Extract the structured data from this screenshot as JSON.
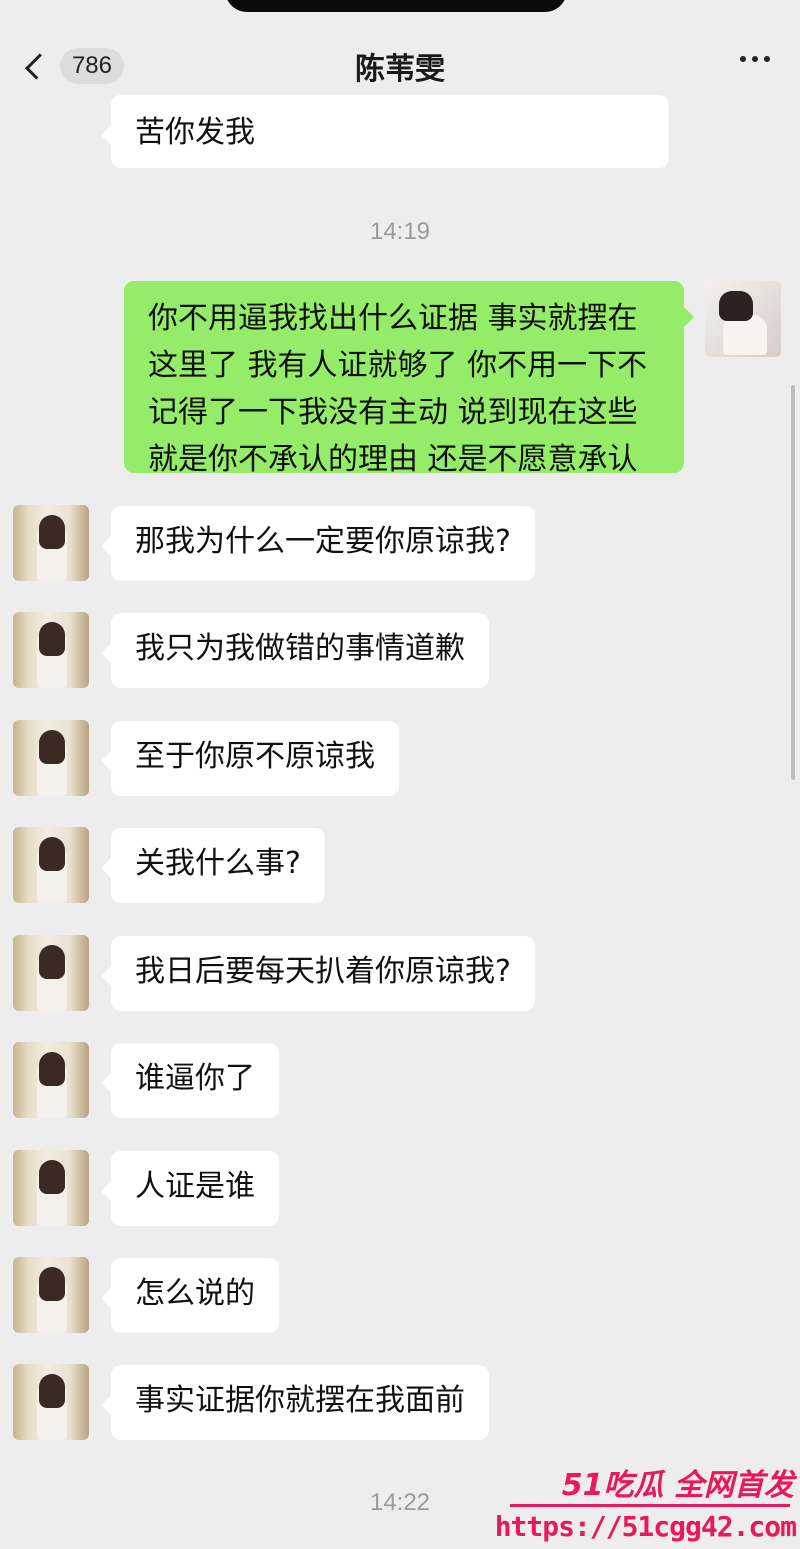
{
  "header": {
    "unread_count": "786",
    "chat_title": "陈苇雯"
  },
  "messages": {
    "partial_top": "苦你发我",
    "time_1": "14:19",
    "me_1": "你不用逼我找出什么证据 事实就摆在这里了 我有人证就够了 你不用一下不记得了一下我没有主动 说到现在这些就是你不承认的理由 还是不愿意承认",
    "left": [
      "那我为什么一定要你原谅我?",
      "我只为我做错的事情道歉",
      "至于你原不原谅我",
      "关我什么事?",
      "我日后要每天扒着你原谅我?",
      "谁逼你了",
      "人证是谁",
      "怎么说的",
      "事实证据你就摆在我面前"
    ],
    "time_2": "14:22"
  },
  "watermark": {
    "brand": "51吃瓜 全网首发",
    "url": "https://51cgg42.com"
  },
  "colors": {
    "background": "#ededed",
    "my_bubble": "#95ec69",
    "their_bubble": "#ffffff",
    "watermark": "#e8185a"
  }
}
